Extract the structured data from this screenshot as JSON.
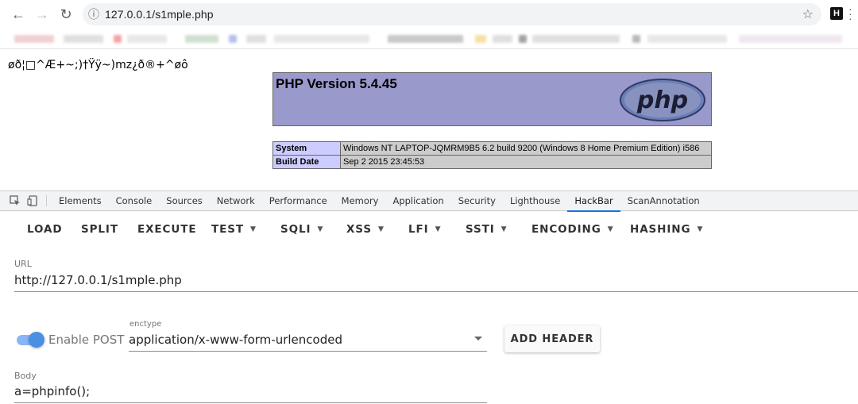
{
  "browser": {
    "url": "127.0.0.1/s1mple.php"
  },
  "page": {
    "garbled_text": "øð¦□^Æ+~;)†Ÿÿ~)mz¿ð®+^øô",
    "php_title": "PHP Version 5.4.45",
    "php_logo_text": "php",
    "info_rows": [
      {
        "key": "System",
        "value": "Windows NT LAPTOP-JQMRM9B5 6.2 build 9200 (Windows 8 Home Premium Edition) i586"
      },
      {
        "key": "Build Date",
        "value": "Sep 2 2015 23:45:53"
      }
    ]
  },
  "devtools": {
    "tabs": [
      "Elements",
      "Console",
      "Sources",
      "Network",
      "Performance",
      "Memory",
      "Application",
      "Security",
      "Lighthouse",
      "HackBar",
      "ScanAnnotation"
    ],
    "active_tab": "HackBar"
  },
  "hackbar": {
    "toolbar": {
      "load": "LOAD",
      "split": "SPLIT",
      "execute": "EXECUTE",
      "test": "TEST",
      "sqli": "SQLI",
      "xss": "XSS",
      "lfi": "LFI",
      "ssti": "SSTI",
      "encoding": "ENCODING",
      "hashing": "HASHING"
    },
    "url_label": "URL",
    "url_value": "http://127.0.0.1/s1mple.php",
    "enable_post_label": "Enable POST",
    "enable_post_on": true,
    "enctype_label": "enctype",
    "enctype_value": "application/x-www-form-urlencoded",
    "add_header_label": "ADD HEADER",
    "body_label": "Body",
    "body_value": "a=phpinfo();"
  },
  "colors": {
    "php_header_bg": "#9999cc",
    "php_key_bg": "#ccccff",
    "php_value_bg": "#cccccc",
    "toggle_accent": "#4a90e2",
    "active_tab_underline": "#1a73e8"
  }
}
